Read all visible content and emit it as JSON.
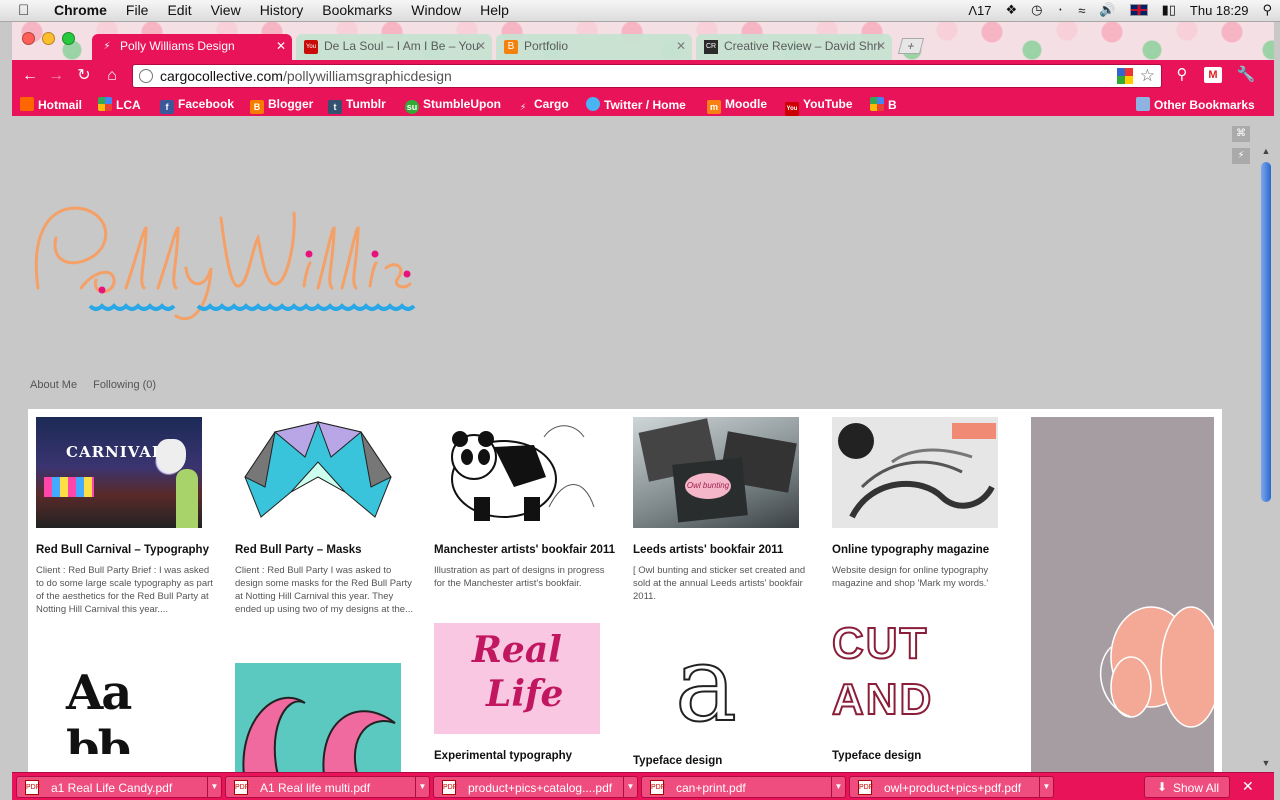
{
  "menubar": {
    "apple": "",
    "items": [
      "Chrome",
      "File",
      "Edit",
      "View",
      "History",
      "Bookmarks",
      "Window",
      "Help"
    ],
    "status": {
      "adobe": "17",
      "clock": "Thu 18:29"
    }
  },
  "tabs": [
    {
      "title": "Polly Williams Design",
      "icon": "cargo-bolt-icon",
      "active": true
    },
    {
      "title": "De La Soul – I Am I Be – You",
      "icon": "youtube-icon",
      "active": false
    },
    {
      "title": "Portfolio",
      "icon": "blogger-icon",
      "active": false
    },
    {
      "title": "Creative Review – David Shri",
      "icon": "cr-icon",
      "active": false
    }
  ],
  "omnibox": {
    "domain": "cargocollective.com",
    "path": "/pollywilliamsgraphicdesign"
  },
  "bookmarks": [
    {
      "label": "Hotmail",
      "icon": "hotmail-icon"
    },
    {
      "label": "LCA",
      "icon": "google-icon"
    },
    {
      "label": "Facebook",
      "icon": "facebook-icon"
    },
    {
      "label": "Blogger",
      "icon": "blogger-icon"
    },
    {
      "label": "Tumblr",
      "icon": "tumblr-icon"
    },
    {
      "label": "StumbleUpon",
      "icon": "stumbleupon-icon"
    },
    {
      "label": "Cargo",
      "icon": "cargo-bolt-icon"
    },
    {
      "label": "Twitter / Home",
      "icon": "twitter-icon"
    },
    {
      "label": "Moodle",
      "icon": "moodle-icon"
    },
    {
      "label": "YouTube",
      "icon": "youtube-icon"
    },
    {
      "label": "B",
      "icon": "google-icon"
    }
  ],
  "other_bookmarks": "Other Bookmarks",
  "site": {
    "nav": [
      "About Me",
      "Following (0)"
    ],
    "projects": [
      {
        "title": "Red Bull Carnival – Typography",
        "desc": "Client : Red Bull Party Brief : I was asked to do some large scale typography as part of the aesthetics for the Red Bull Party at Notting Hill Carnival this year...."
      },
      {
        "title": "Red Bull Party – Masks",
        "desc": "Client : Red Bull Party I was asked to design some masks for the Red Bull Party at Notting Hill Carnival this year. They ended up using two of my designs at the..."
      },
      {
        "title": "Manchester artists' bookfair 2011",
        "desc": "Illustration as part of designs in progress for the Manchester artist's bookfair."
      },
      {
        "title": "Leeds artists' bookfair 2011",
        "desc": "[ Owl bunting and sticker set created and sold at the annual Leeds artists' bookfair 2011."
      },
      {
        "title": "Online typography magazine",
        "desc": "Website design for online typography magazine and shop 'Mark my words.'"
      },
      {
        "title": "Experimental typography",
        "desc": ""
      },
      {
        "title": "Typeface design",
        "desc": ""
      },
      {
        "title": "Typeface design",
        "desc": ""
      }
    ],
    "thumb_text": {
      "carnival": "CARNIVAL",
      "reallife_1": "Real",
      "reallife_2": "Life",
      "cut_1": "CUT",
      "cut_2": "AND",
      "letter_a": "a",
      "ab": "Aa bb",
      "owl_bunting": "Owl bunting"
    }
  },
  "downloads": [
    "a1 Real Life Candy.pdf",
    "A1 Real life multi.pdf",
    "product+pics+catalog....pdf",
    "can+print.pdf",
    "owl+product+pics+pdf.pdf"
  ],
  "show_all": "Show All",
  "colors": {
    "chrome_pink": "#e9135a",
    "logo_orange": "#f4a066",
    "logo_blue": "#2aa7e6",
    "logo_pink": "#e8137a"
  }
}
